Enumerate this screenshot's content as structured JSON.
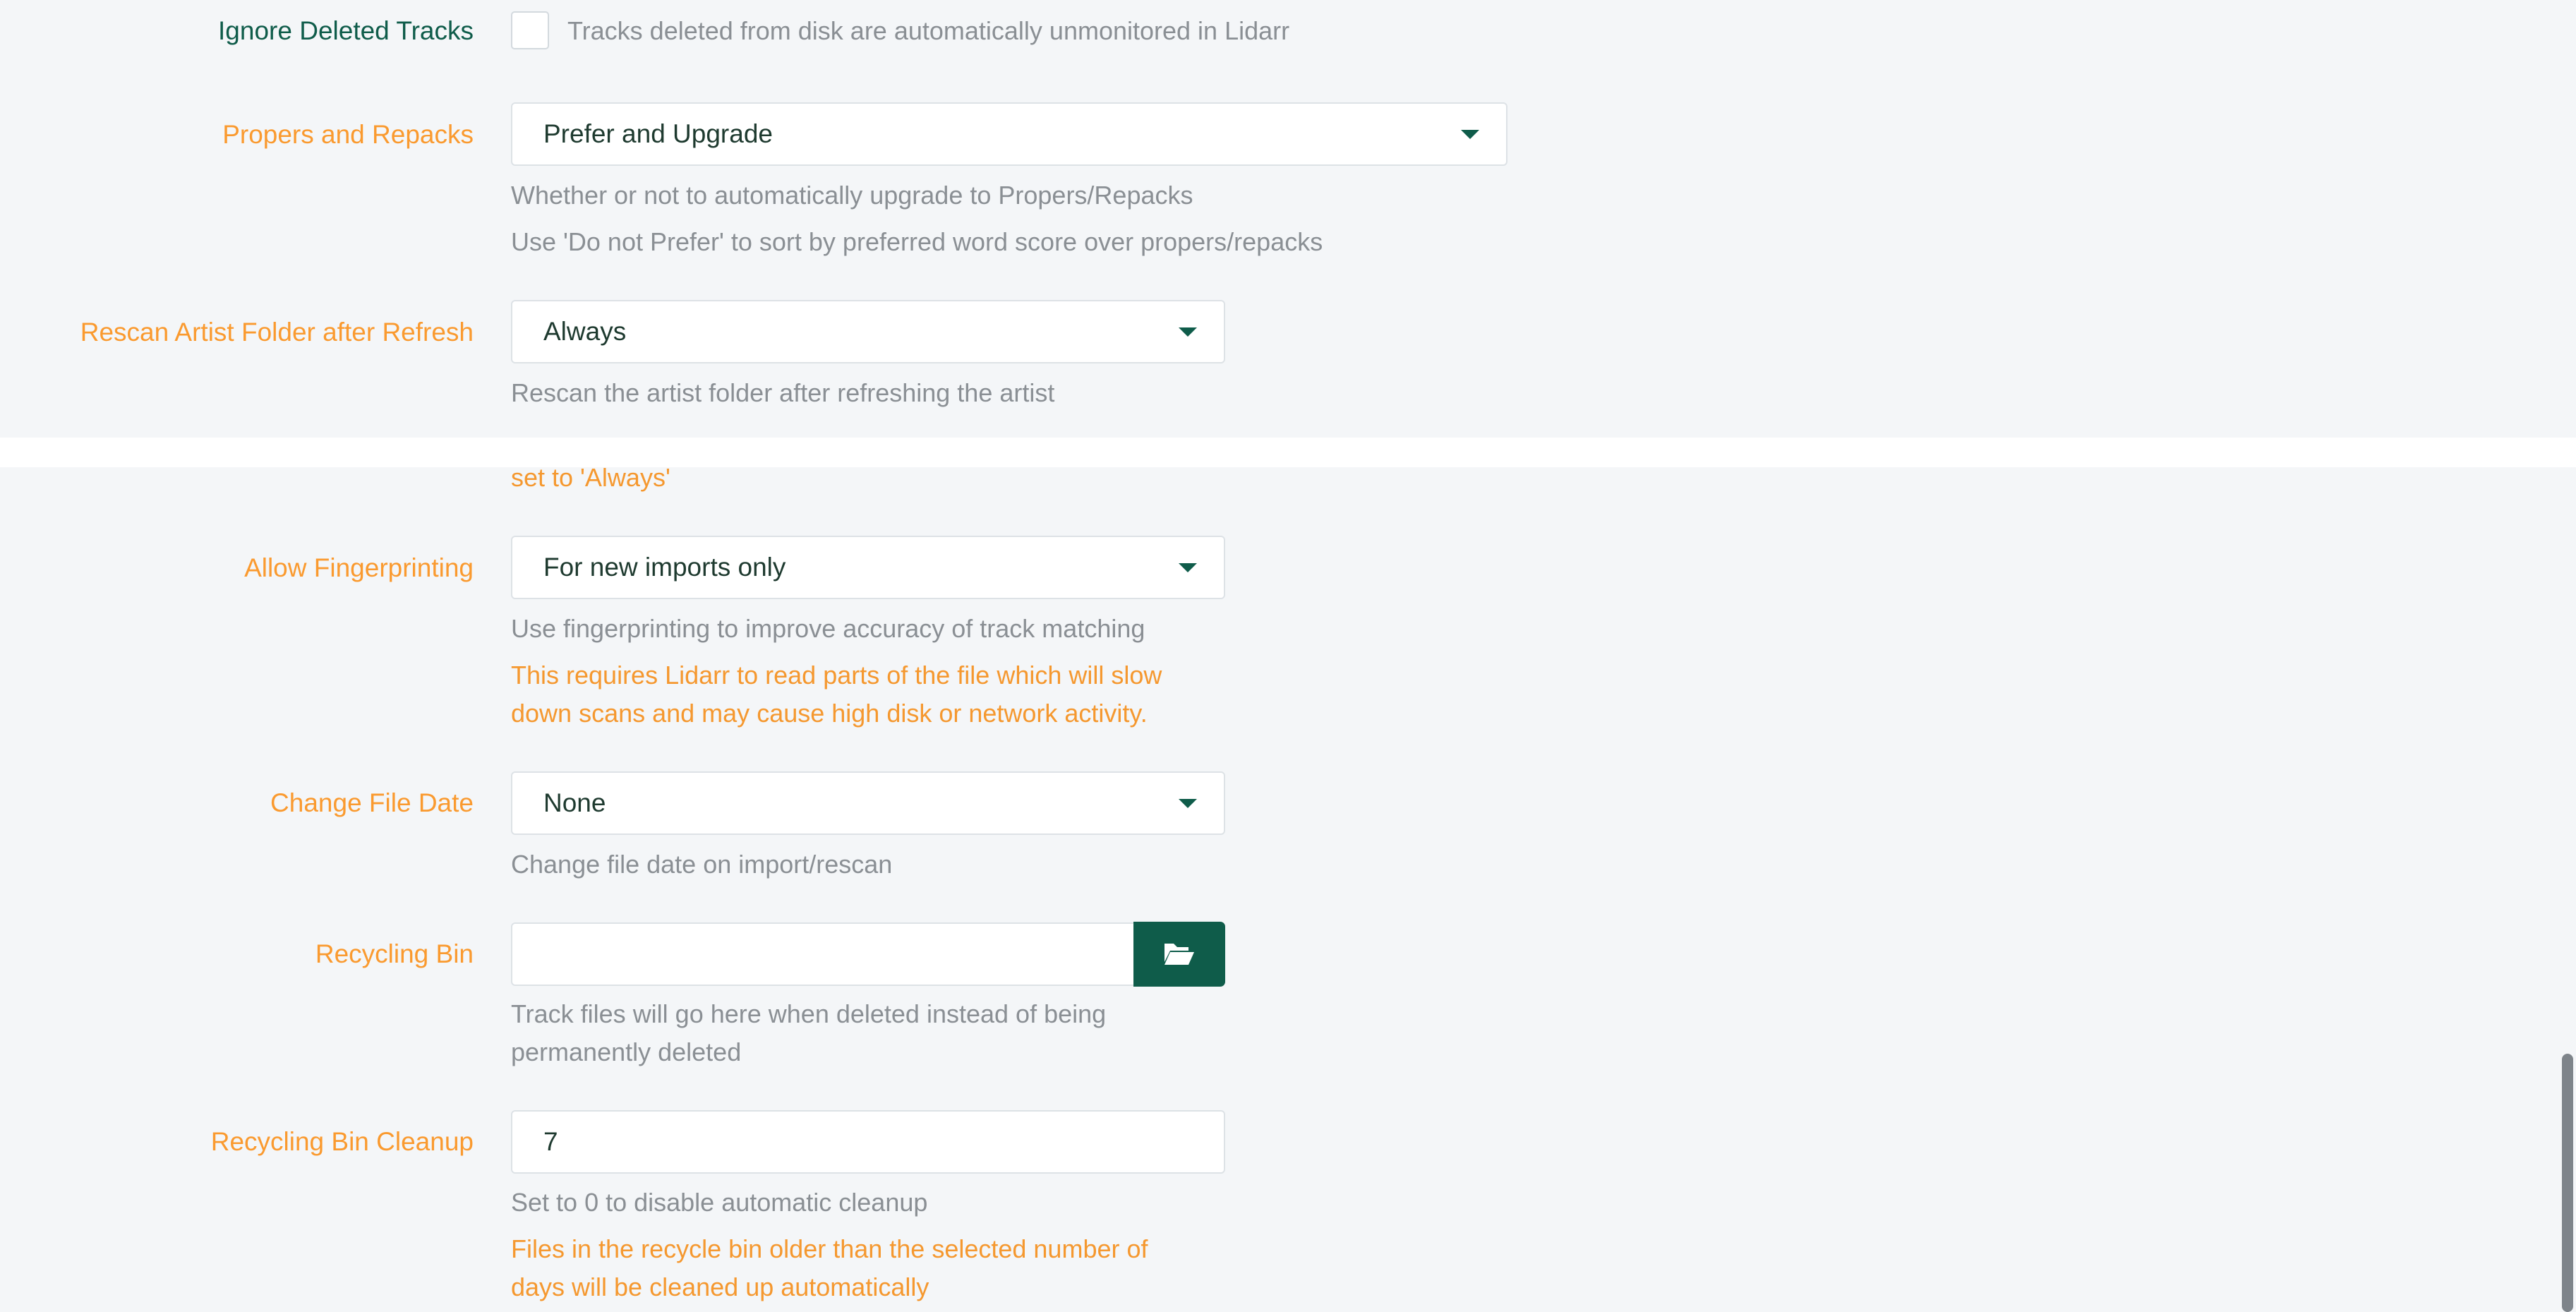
{
  "settings": {
    "ignore_deleted_tracks": {
      "label": "Ignore Deleted Tracks",
      "checked": false,
      "help": "Tracks deleted from disk are automatically unmonitored in Lidarr"
    },
    "propers_and_repacks": {
      "label": "Propers and Repacks",
      "value": "Prefer and Upgrade",
      "help1": "Whether or not to automatically upgrade to Propers/Repacks",
      "help2": "Use 'Do not Prefer' to sort by preferred word score over propers/repacks"
    },
    "rescan_artist_folder": {
      "label": "Rescan Artist Folder after Refresh",
      "value": "Always",
      "help": "Rescan the artist folder after refreshing the artist",
      "warning_partial": "set to 'Always'"
    },
    "allow_fingerprinting": {
      "label": "Allow Fingerprinting",
      "value": "For new imports only",
      "help": "Use fingerprinting to improve accuracy of track matching",
      "warning_line1": "This requires Lidarr to read parts of the file which will slow",
      "warning_line2": "down scans and may cause high disk or network activity."
    },
    "change_file_date": {
      "label": "Change File Date",
      "value": "None",
      "help": "Change file date on import/rescan"
    },
    "recycling_bin": {
      "label": "Recycling Bin",
      "value": "",
      "help_line1": "Track files will go here when deleted instead of being",
      "help_line2": "permanently deleted"
    },
    "recycling_bin_cleanup": {
      "label": "Recycling Bin Cleanup",
      "value": "7",
      "help": "Set to 0 to disable automatic cleanup",
      "warning_line1": "Files in the recycle bin older than the selected number of",
      "warning_line2": "days will be cleaned up automatically"
    }
  },
  "icons": {
    "dropdown": "caret-down-icon",
    "folder": "folder-open-icon"
  },
  "colors": {
    "accent": "#0f5c4a",
    "warning_label": "#fa9a2f",
    "help_text": "#8a8f94",
    "background": "#f4f6f8"
  }
}
